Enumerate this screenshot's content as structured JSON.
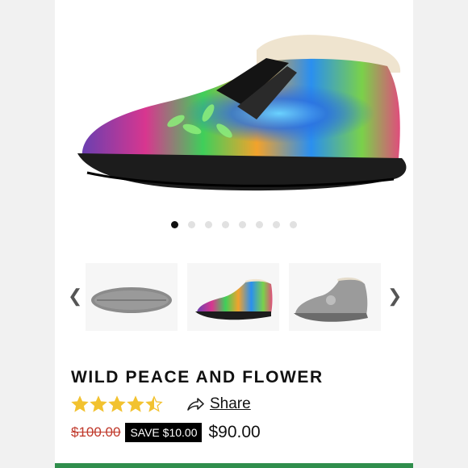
{
  "carousel": {
    "slide_count": 8,
    "active_index": 0,
    "prev_icon": "chevron-left-icon",
    "next_icon": "chevron-right-icon"
  },
  "product": {
    "title": "WILD PEACE AND FLOWER",
    "rating": 4.5,
    "rating_max": 5,
    "share_label": "Share",
    "share_icon": "share-arrow-icon",
    "old_price": "$100.00",
    "save_badge": "SAVE $10.00",
    "price": "$90.00"
  },
  "colors": {
    "star": "#f2c230",
    "old_price": "#c0392b",
    "accent_bar": "#2f8e4c",
    "sole": "#1c1c1c",
    "fur": "#efe4cf"
  }
}
